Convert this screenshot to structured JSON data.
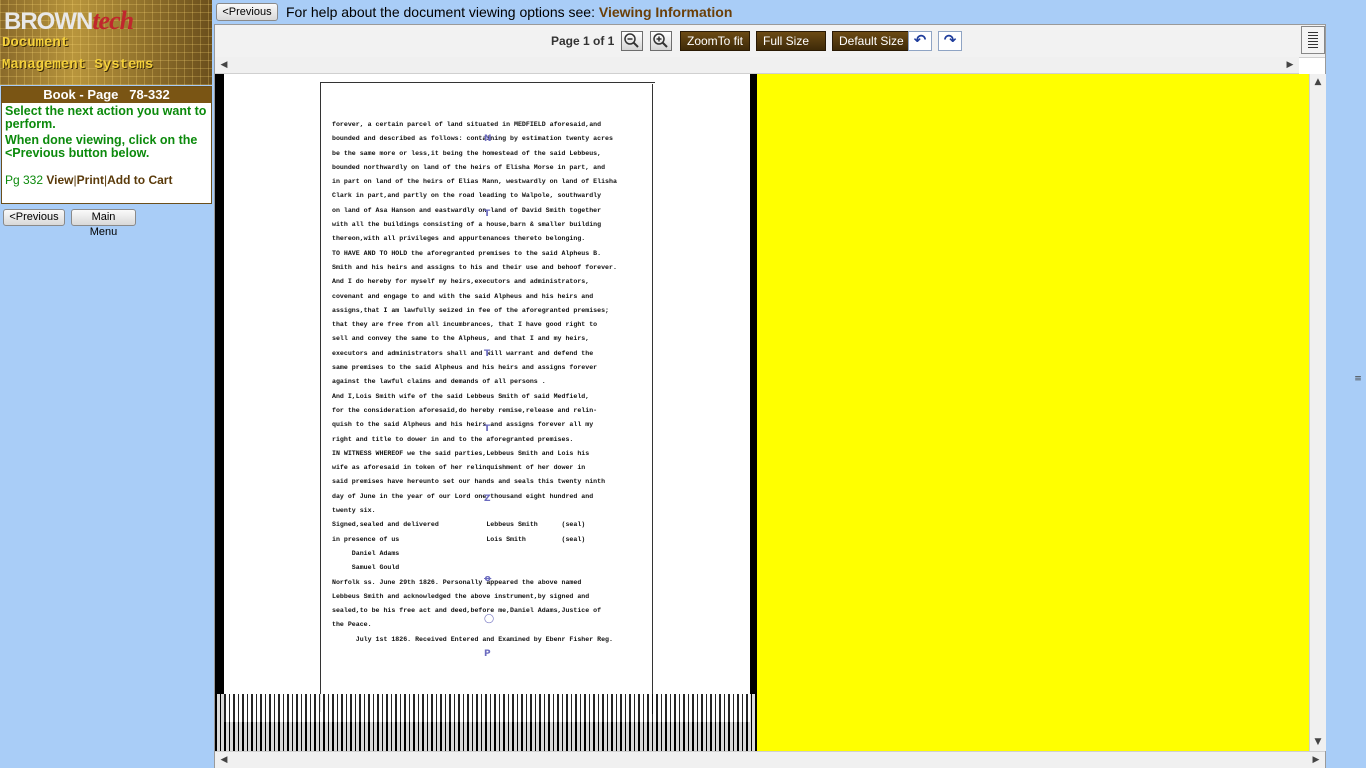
{
  "brand": {
    "name_a": "BROWN",
    "name_b": "tech",
    "line1": "Document",
    "line2": "Management Systems"
  },
  "info": {
    "book_page": "Book - Page   78-332",
    "msg1": "Select the next action you want to perform.",
    "msg2": "When done viewing, click on the <Previous button below.",
    "pg_label": "Pg 332",
    "view": "View",
    "print": "Print",
    "add_cart": "Add to Cart",
    "sep": "|"
  },
  "left_buttons": {
    "previous": "<Previous",
    "main_menu": "Main Menu"
  },
  "top": {
    "previous": "<Previous",
    "help_text": "For help about the document viewing options see:",
    "help_link": "Viewing Information"
  },
  "toolbar": {
    "page_label": "Page 1 of 1",
    "zoom_fit": "ZoomTo fit",
    "full_size": "Full Size",
    "default_size": "Default Size",
    "zoom_out_icon": "zoom-out-icon",
    "zoom_in_icon": "zoom-in-icon",
    "rotate_left_icon": "rotate-left-icon",
    "rotate_right_icon": "rotate-right-icon",
    "rotate_left_glyph": "↶",
    "rotate_right_glyph": "↷"
  },
  "document": {
    "lines": [
      "forever, a certain parcel of land situated in MEDFIELD aforesaid,and",
      "bounded and described as follows: containing by estimation twenty acres",
      "be the same more or less,it being the homestead of the said Lebbeus,",
      "bounded northwardly on land of the heirs of Elisha Morse in part, and",
      "in part on land of the heirs of Elias Mann, westwardly on land of Elisha",
      "Clark in part,and partly on the road leading to Walpole, southwardly",
      "on land of Asa Hanson and eastwardly on land of David Smith together",
      "with all the buildings consisting of a house,barn & smaller building",
      "thereon,with all privileges and appurtenances thereto belonging.",
      "TO HAVE AND TO HOLD the aforegranted premises to the said Alpheus B.",
      "Smith and his heirs and assigns to his and their use and behoof forever.",
      "And I do hereby for myself my heirs,executors and administrators,",
      "covenant and engage to and with the said Alpheus and his heirs and",
      "assigns,that I am lawfully seized in fee of the aforegranted premises;",
      "that they are free from all incumbrances, that I have good right to",
      "sell and convey the same to the Alpheus, and that I and my heirs,",
      "executors and administrators shall and will warrant and defend the",
      "same premises to the said Alpheus and his heirs and assigns forever",
      "against the lawful claims and demands of all persons .",
      "And I,Lois Smith wife of the said Lebbeus Smith of said Medfield,",
      "for the consideration aforesaid,do hereby remise,release and relin-",
      "quish to the said Alpheus and his heirs and assigns forever all my",
      "right and title to dower in and to the aforegranted premises.",
      "IN WITNESS WHEREOF we the said parties,Lebbeus Smith and Lois his",
      "wife as aforesaid in token of her relinquishment of her dower in",
      "said premises have hereunto set our hands and seals this twenty ninth",
      "day of June in the year of our Lord one thousand eight hundred and",
      "twenty six.",
      "Signed,sealed and delivered            Lebbeus Smith      (seal)",
      "in presence of us                      Lois Smith         (seal)",
      "     Daniel Adams",
      "     Samuel Gould",
      "Norfolk ss. June 29th 1826. Personally appeared the above named",
      "Lebbeus Smith and acknowledged the above instrument,by signed and",
      "sealed,to be his free act and deed,before me,Daniel Adams,Justice of",
      "the Peace.",
      "      July 1st 1826. Received Entered and Examined by Ebenr Fisher Reg."
    ]
  },
  "colors": {
    "highlight": "#ffff00",
    "brown": "#7a5514",
    "green": "#0c8a0c",
    "background": "#a9cdf7"
  }
}
